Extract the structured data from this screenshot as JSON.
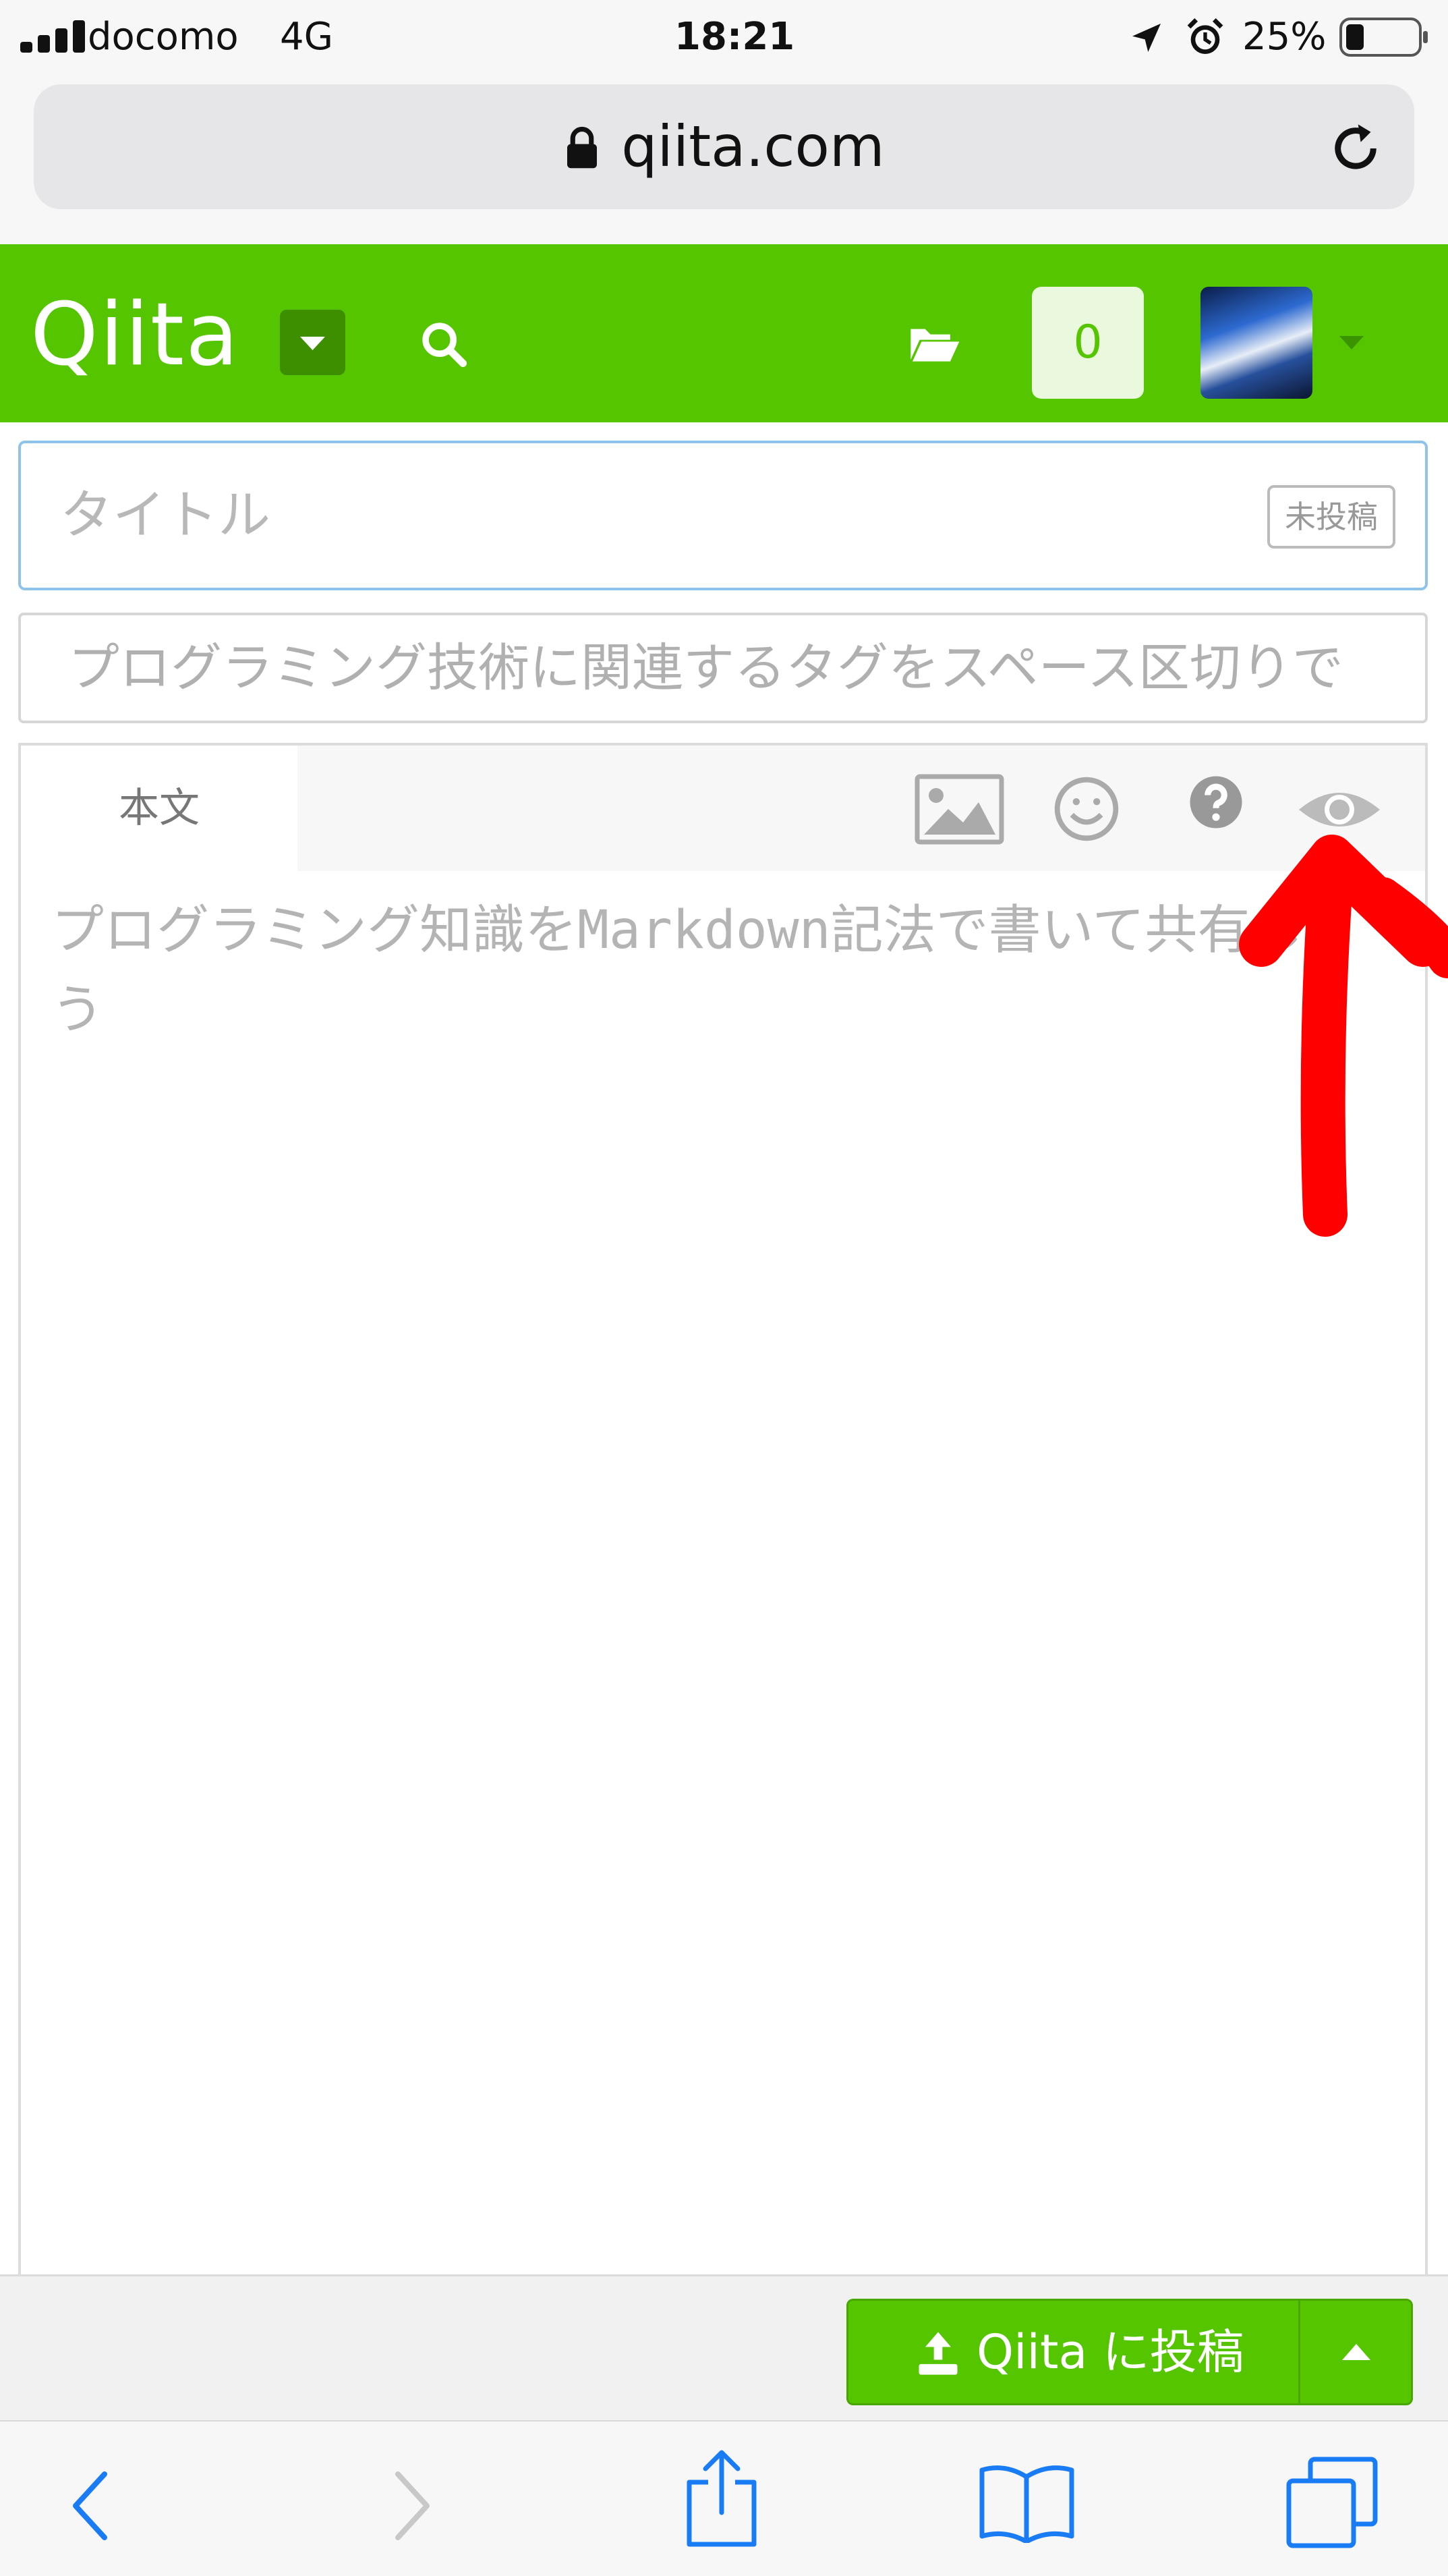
{
  "status_bar": {
    "carrier": "docomo",
    "network": "4G",
    "time": "18:21",
    "battery": "25%",
    "battery_level": 0.25
  },
  "browser": {
    "url": "qiita.com"
  },
  "header": {
    "logo": "Qiita",
    "notification_count": "0"
  },
  "editor": {
    "title_placeholder": "タイトル",
    "draft_badge": "未投稿",
    "tags_placeholder": "プログラミング技術に関連するタグをスペース区切りで",
    "body_tab": "本文",
    "body_placeholder": "プログラミング知識をMarkdown記法で書いて共有しよう"
  },
  "actions": {
    "post_label": "Qiita に投稿"
  },
  "colors": {
    "brand": "#55c500",
    "annotation": "#ff0000"
  },
  "icons": [
    "signal-icon",
    "location-icon",
    "alarm-icon",
    "battery-icon",
    "lock-icon",
    "reload-icon",
    "caret-down-icon",
    "search-icon",
    "folder-icon",
    "image-icon",
    "emoji-icon",
    "help-icon",
    "eye-icon",
    "upload-icon",
    "caret-up-icon",
    "back-icon",
    "forward-icon",
    "share-icon",
    "bookmarks-icon",
    "tabs-icon",
    "arrow-annotation"
  ]
}
